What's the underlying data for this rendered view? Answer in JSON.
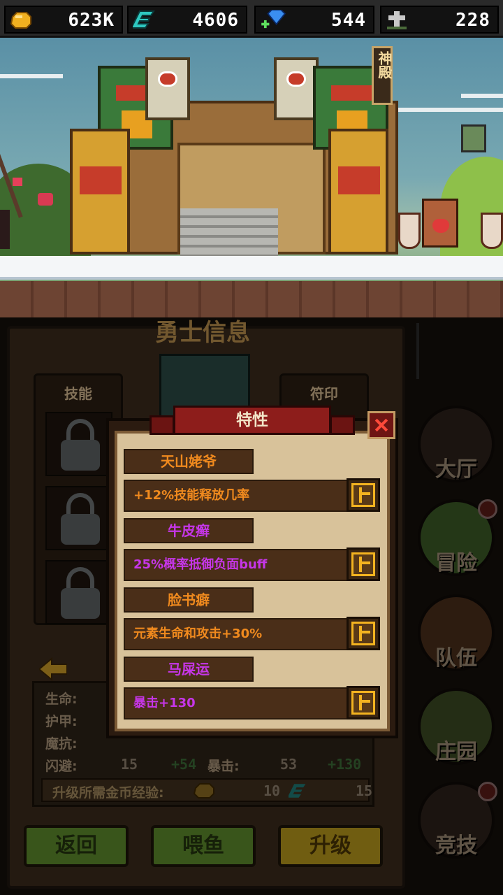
{
  "resources": [
    {
      "icon": "gold-icon",
      "value": "623K",
      "color": "#f0b020"
    },
    {
      "icon": "element-e-icon",
      "value": "4606",
      "color": "#2ec8c0"
    },
    {
      "icon": "diamond-plus-icon",
      "value": "544",
      "color": "#3a8ef0"
    },
    {
      "icon": "tombstone-cross-icon",
      "value": "228",
      "color": "#c8c8c8"
    }
  ],
  "scene": {
    "temple_sign": "神殿"
  },
  "hero": {
    "title": "勇士信息",
    "skills_label": "技能",
    "runes_label": "符印",
    "stats": {
      "hp_label": "生命:",
      "armor_label": "护甲:",
      "resist_label": "魔抗:",
      "dodge_label": "闪避:",
      "dodge_value": "15",
      "dodge_bonus": "+54",
      "crit_label": "暴击:",
      "crit_value": "53",
      "crit_bonus": "+130",
      "upgrade_cost_label": "升级所需金币经验:",
      "gold_cost": "10",
      "exp_cost": "15"
    },
    "buttons": {
      "back": "返回",
      "feed": "喂鱼",
      "upgrade": "升级"
    }
  },
  "nav": [
    {
      "label": "大厅",
      "icon": "hall-icon",
      "alert": false
    },
    {
      "label": "冒险",
      "icon": "adventure-icon",
      "alert": true
    },
    {
      "label": "队伍",
      "icon": "team-icon",
      "alert": false
    },
    {
      "label": "庄园",
      "icon": "manor-icon",
      "alert": false
    },
    {
      "label": "竞技",
      "icon": "arena-swords-icon",
      "alert": true
    }
  ],
  "modal": {
    "title": "特性",
    "traits": [
      {
        "name": "天山姥爷",
        "name_color": "#f08a1e",
        "desc": "+12%技能释放几率",
        "desc_color": "#f08a1e"
      },
      {
        "name": "牛皮癣",
        "name_color": "#c636e8",
        "desc": "25%概率抵御负面buff",
        "desc_color": "#c636e8"
      },
      {
        "name": "脸书癖",
        "name_color": "#f08a1e",
        "desc": "元素生命和攻击+30%",
        "desc_color": "#f08a1e"
      },
      {
        "name": "马屎运",
        "name_color": "#c636e8",
        "desc": "暴击+130",
        "desc_color": "#c636e8"
      }
    ]
  }
}
